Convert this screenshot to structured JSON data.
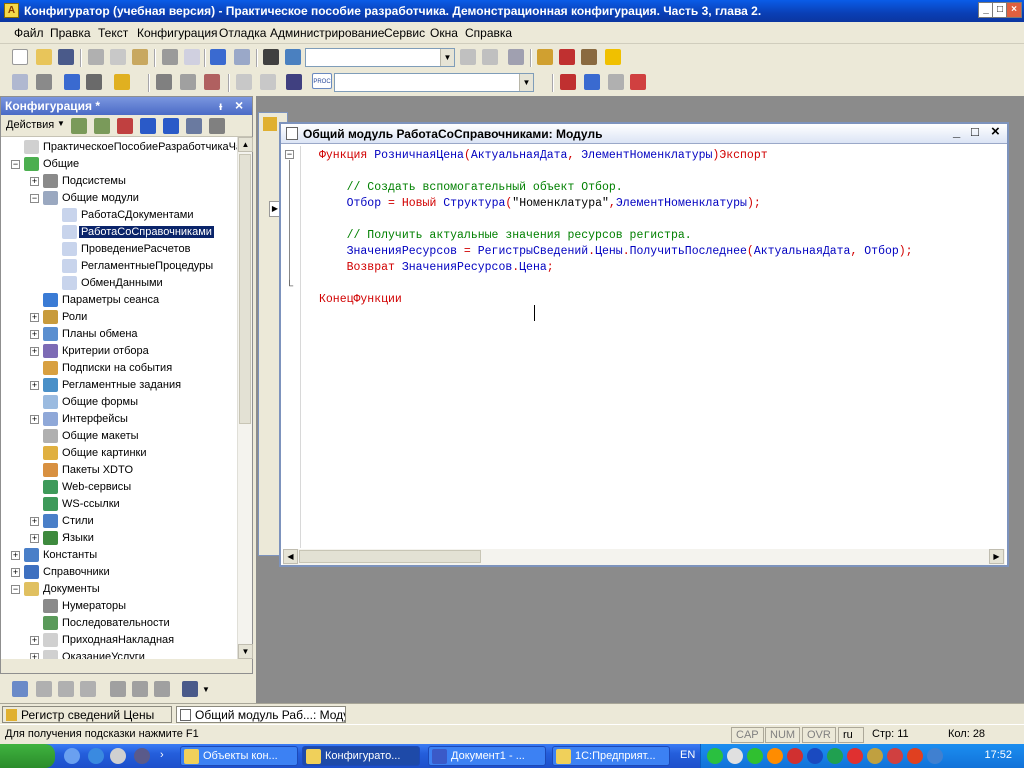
{
  "window": {
    "title": "Конфигуратор (учебная версия) - Практическое пособие разработчика. Демонстрационная конфигурация. Часть 3, глава 2.",
    "icon_label": "A",
    "minimize": "_",
    "maximize": "□",
    "close": "×"
  },
  "menu": [
    "Файл",
    "Правка",
    "Текст",
    "Конфигурация",
    "Отладка",
    "Администрирование",
    "Сервис",
    "Окна",
    "Справка"
  ],
  "toolbar": {
    "search_combo_value": "",
    "proc_label": "PROC",
    "proc_combo_value": ""
  },
  "panel": {
    "title": "Конфигурация *",
    "pin": "ᵻ",
    "close": "×",
    "actions_label": "Действия"
  },
  "tree": [
    {
      "label": "ПрактическоеПособиеРазработчикаЧаст",
      "level": 0,
      "expander": "",
      "icon": "root-config-icon",
      "color": "#d0d0d0"
    },
    {
      "label": "Общие",
      "level": 0,
      "expander": "−",
      "icon": "common-icon",
      "color": "#4caf50"
    },
    {
      "label": "Подсистемы",
      "level": 1,
      "expander": "+",
      "icon": "subsystems-icon",
      "color": "#8a8a8a"
    },
    {
      "label": "Общие модули",
      "level": 1,
      "expander": "−",
      "icon": "common-modules-icon",
      "color": "#9aa8c0"
    },
    {
      "label": "РаботаСДокументами",
      "level": 2,
      "expander": "",
      "icon": "module-icon",
      "color": "#c8d4ec"
    },
    {
      "label": "РаботаСоСправочниками",
      "level": 2,
      "expander": "",
      "icon": "module-icon",
      "color": "#c8d4ec",
      "selected": true
    },
    {
      "label": "ПроведениеРасчетов",
      "level": 2,
      "expander": "",
      "icon": "module-icon",
      "color": "#c8d4ec"
    },
    {
      "label": "РегламентныеПроцедуры",
      "level": 2,
      "expander": "",
      "icon": "module-icon",
      "color": "#c8d4ec"
    },
    {
      "label": "ОбменДанными",
      "level": 2,
      "expander": "",
      "icon": "module-icon",
      "color": "#c8d4ec"
    },
    {
      "label": "Параметры сеанса",
      "level": 1,
      "expander": "",
      "icon": "session-params-icon",
      "color": "#3a7bd5"
    },
    {
      "label": "Роли",
      "level": 1,
      "expander": "+",
      "icon": "roles-icon",
      "color": "#c89b3c"
    },
    {
      "label": "Планы обмена",
      "level": 1,
      "expander": "+",
      "icon": "exchange-plans-icon",
      "color": "#5b8fd0"
    },
    {
      "label": "Критерии отбора",
      "level": 1,
      "expander": "+",
      "icon": "filter-criteria-icon",
      "color": "#7d6bb5"
    },
    {
      "label": "Подписки на события",
      "level": 1,
      "expander": "",
      "icon": "event-subscriptions-icon",
      "color": "#d8a040"
    },
    {
      "label": "Регламентные задания",
      "level": 1,
      "expander": "+",
      "icon": "scheduled-jobs-icon",
      "color": "#4a90c8"
    },
    {
      "label": "Общие формы",
      "level": 1,
      "expander": "",
      "icon": "common-forms-icon",
      "color": "#9bbbe0"
    },
    {
      "label": "Интерфейсы",
      "level": 1,
      "expander": "+",
      "icon": "interfaces-icon",
      "color": "#8fa8d8"
    },
    {
      "label": "Общие макеты",
      "level": 1,
      "expander": "",
      "icon": "common-templates-icon",
      "color": "#b0b0b0"
    },
    {
      "label": "Общие картинки",
      "level": 1,
      "expander": "",
      "icon": "common-pictures-icon",
      "color": "#e0b040"
    },
    {
      "label": "Пакеты XDTO",
      "level": 1,
      "expander": "",
      "icon": "xdto-icon",
      "color": "#d89040"
    },
    {
      "label": "Web-сервисы",
      "level": 1,
      "expander": "",
      "icon": "web-services-icon",
      "color": "#3e9a5a"
    },
    {
      "label": "WS-ссылки",
      "level": 1,
      "expander": "",
      "icon": "ws-links-icon",
      "color": "#3e9a5a"
    },
    {
      "label": "Стили",
      "level": 1,
      "expander": "+",
      "icon": "styles-icon",
      "color": "#4a7fc8"
    },
    {
      "label": "Языки",
      "level": 1,
      "expander": "+",
      "icon": "languages-icon",
      "color": "#3e8a3e"
    },
    {
      "label": "Константы",
      "level": 0,
      "expander": "+",
      "icon": "constants-icon",
      "color": "#4a7fc8"
    },
    {
      "label": "Справочники",
      "level": 0,
      "expander": "+",
      "icon": "catalogs-icon",
      "color": "#3e70c0"
    },
    {
      "label": "Документы",
      "level": 0,
      "expander": "−",
      "icon": "documents-icon",
      "color": "#e0c060"
    },
    {
      "label": "Нумераторы",
      "level": 1,
      "expander": "",
      "icon": "numerators-icon",
      "color": "#8a8a8a"
    },
    {
      "label": "Последовательности",
      "level": 1,
      "expander": "",
      "icon": "sequences-icon",
      "color": "#5a9a5a"
    },
    {
      "label": "ПриходнаяНакладная",
      "level": 1,
      "expander": "+",
      "icon": "document-icon",
      "color": "#d0d0d0"
    },
    {
      "label": "ОказаниеУслуги",
      "level": 1,
      "expander": "+",
      "icon": "document-icon",
      "color": "#d0d0d0"
    }
  ],
  "editor": {
    "title": "Общий модуль РаботаСоСправочниками: Модуль",
    "fold_top": "−",
    "fold_end": "└",
    "lines": [
      [
        {
          "t": "Функция ",
          "c": "kw"
        },
        {
          "t": "РозничнаяЦена",
          "c": "id"
        },
        {
          "t": "(",
          "c": "op"
        },
        {
          "t": "АктуальнаяДата",
          "c": "id"
        },
        {
          "t": ", ",
          "c": "op"
        },
        {
          "t": "ЭлементНоменклатуры",
          "c": "id"
        },
        {
          "t": ")",
          "c": "op"
        },
        {
          "t": "Экспорт",
          "c": "kw"
        }
      ],
      [],
      [
        {
          "t": "    // Создать вспомогательный объект Отбор.",
          "c": "cm"
        }
      ],
      [
        {
          "t": "    Отбор",
          "c": "id"
        },
        {
          "t": " = ",
          "c": "op"
        },
        {
          "t": "Новый ",
          "c": "kw"
        },
        {
          "t": "Структура",
          "c": "id"
        },
        {
          "t": "(",
          "c": "op"
        },
        {
          "t": "\"Номенклатура\"",
          "c": "st"
        },
        {
          "t": ",",
          "c": "op"
        },
        {
          "t": "ЭлементНоменклатуры",
          "c": "id"
        },
        {
          "t": ");",
          "c": "op"
        }
      ],
      [],
      [
        {
          "t": "    // Получить актуальные значения ресурсов регистра.",
          "c": "cm"
        }
      ],
      [
        {
          "t": "    ЗначенияРесурсов",
          "c": "id"
        },
        {
          "t": " = ",
          "c": "op"
        },
        {
          "t": "РегистрыСведений",
          "c": "id"
        },
        {
          "t": ".",
          "c": "op"
        },
        {
          "t": "Цены",
          "c": "id"
        },
        {
          "t": ".",
          "c": "op"
        },
        {
          "t": "ПолучитьПоследнее",
          "c": "id"
        },
        {
          "t": "(",
          "c": "op"
        },
        {
          "t": "АктуальнаяДата",
          "c": "id"
        },
        {
          "t": ", ",
          "c": "op"
        },
        {
          "t": "Отбор",
          "c": "id"
        },
        {
          "t": ");",
          "c": "op"
        }
      ],
      [
        {
          "t": "    Возврат ",
          "c": "kw"
        },
        {
          "t": "ЗначенияРесурсов",
          "c": "id"
        },
        {
          "t": ".",
          "c": "op"
        },
        {
          "t": "Цена",
          "c": "id"
        },
        {
          "t": ";",
          "c": "op"
        }
      ],
      [],
      [
        {
          "t": "КонецФункции",
          "c": "kw"
        }
      ]
    ]
  },
  "window_tabs": [
    {
      "label": "Регистр сведений Цены"
    },
    {
      "label": "Общий модуль Раб...: Модуль"
    }
  ],
  "status": {
    "hint": "Для получения подсказки нажмите F1",
    "cap": "CAP",
    "num": "NUM",
    "ovr": "OVR",
    "lang": "ru",
    "line": "Стр: 11",
    "col": "Кол: 28"
  },
  "taskbar": {
    "tasks": [
      "Объекты кон...",
      "Конфигурато...",
      "Документ1 - ...",
      "1С:Предприят..."
    ],
    "lang": "EN",
    "clock": "17:52"
  }
}
